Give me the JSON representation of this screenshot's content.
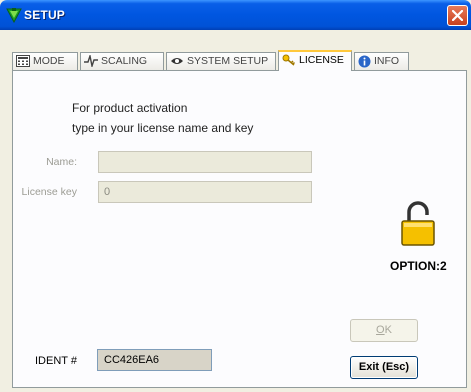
{
  "window": {
    "title": "SETUP"
  },
  "tabs": [
    {
      "label": "MODE",
      "icon": "calculator-icon"
    },
    {
      "label": "SCALING",
      "icon": "waveform-icon"
    },
    {
      "label": "SYSTEM SETUP",
      "icon": "eye-icon"
    },
    {
      "label": "LICENSE",
      "icon": "key-icon"
    },
    {
      "label": "INFO",
      "icon": "info-icon"
    }
  ],
  "active_tab": "LICENSE",
  "license": {
    "instruction_line1": "For product activation",
    "instruction_line2": "type in your license name and key",
    "name_label": "Name:",
    "name_value": "",
    "key_label": "License key",
    "key_value": "0",
    "option_text": "OPTION:2",
    "lock_icon": "unlocked-padlock-icon"
  },
  "ident": {
    "label": "IDENT #",
    "value": "CC426EA6"
  },
  "buttons": {
    "ok_mnemonic": "O",
    "ok_rest": "K",
    "exit": "Exit (Esc)"
  },
  "colors": {
    "title_bar": "#0056e0",
    "close_button": "#c8401d",
    "lock": "#f5c000",
    "active_tab_accent": "#ffc83c"
  }
}
